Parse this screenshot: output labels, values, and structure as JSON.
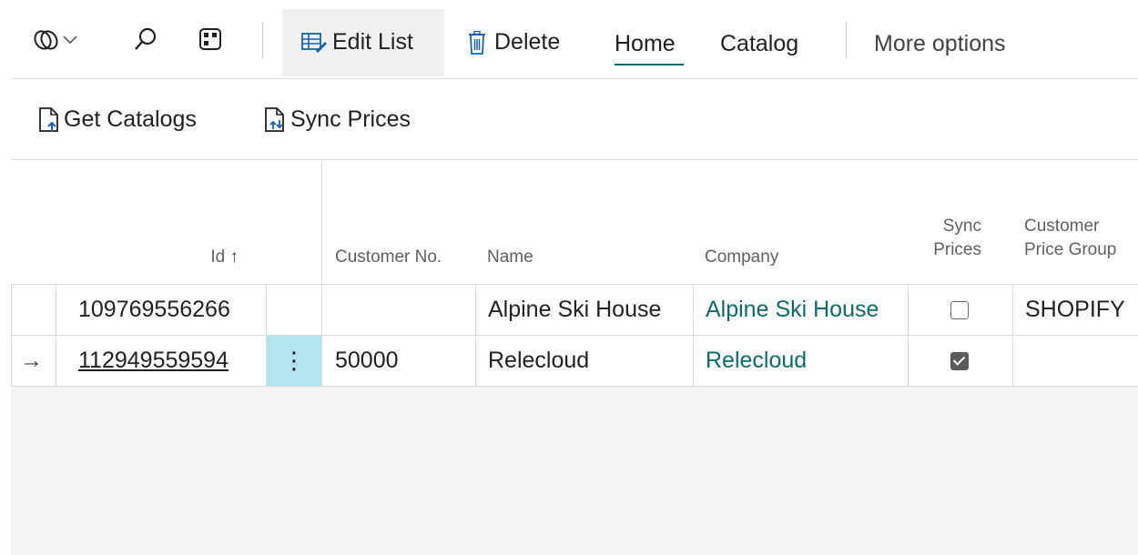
{
  "toolbar": {
    "edit_list": "Edit List",
    "delete": "Delete",
    "home": "Home",
    "catalog": "Catalog",
    "more_options": "More options"
  },
  "actions": {
    "get_catalogs": "Get Catalogs",
    "sync_prices": "Sync Prices"
  },
  "table": {
    "headers": {
      "id": "Id",
      "id_sort": "↑",
      "customer_no": "Customer No.",
      "name": "Name",
      "company": "Company",
      "sync_prices_1": "Sync",
      "sync_prices_2": "Prices",
      "customer_price_group_1": "Customer",
      "customer_price_group_2": "Price Group"
    },
    "rows": [
      {
        "id": "109769556266",
        "customer_no": "",
        "name": "Alpine Ski House",
        "company": "Alpine Ski House",
        "sync_prices": false,
        "price_group": "SHOPIFY"
      },
      {
        "id": "112949559594",
        "customer_no": "50000",
        "name": "Relecloud",
        "company": "Relecloud",
        "sync_prices": true,
        "price_group": ""
      }
    ],
    "row_menu_glyph": "⋮",
    "current_row_glyph": "→"
  },
  "colors": {
    "accent": "#0f6b6b",
    "selected_cell": "#b3e5ee"
  }
}
